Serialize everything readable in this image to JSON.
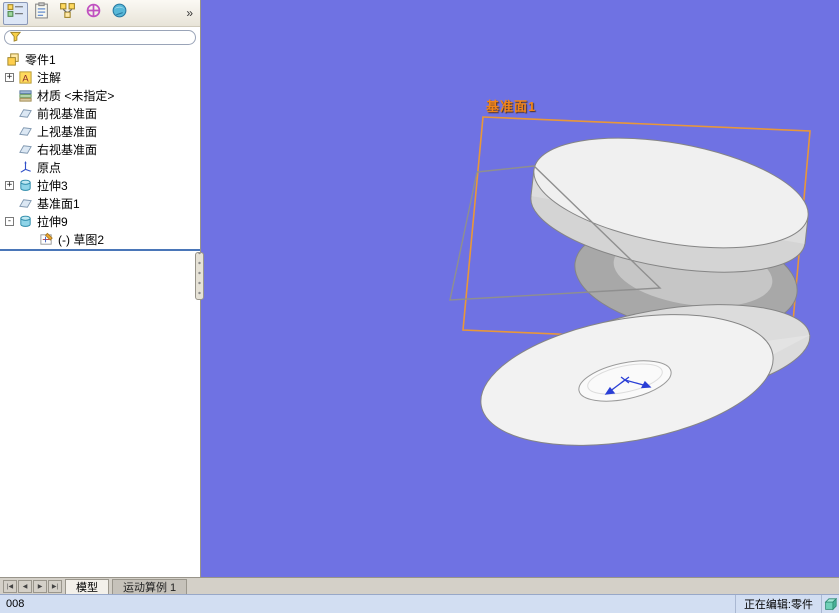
{
  "panel": {
    "toolbar": {
      "overflow_label": "»",
      "icons": [
        "featuremanager-tree-icon",
        "propertymanager-icon",
        "configurationmanager-icon",
        "dimxpertmanager-icon",
        "displaymanager-icon"
      ]
    },
    "filter": {
      "placeholder": "",
      "icon": "filter-funnel-icon"
    },
    "tree": [
      {
        "label": "零件1",
        "icon": "part-icon",
        "expand": ""
      },
      {
        "label": "注解",
        "icon": "annotations-icon",
        "expand": "+"
      },
      {
        "label": "材质 <未指定>",
        "icon": "material-icon",
        "expand": ""
      },
      {
        "label": "前视基准面",
        "icon": "plane-icon",
        "expand": ""
      },
      {
        "label": "上视基准面",
        "icon": "plane-icon",
        "expand": ""
      },
      {
        "label": "右视基准面",
        "icon": "plane-icon",
        "expand": ""
      },
      {
        "label": "原点",
        "icon": "origin-icon",
        "expand": ""
      },
      {
        "label": "拉伸3",
        "icon": "extrude-icon",
        "expand": "+"
      },
      {
        "label": "基准面1",
        "icon": "plane-icon",
        "expand": ""
      },
      {
        "label": "拉伸9",
        "icon": "extrude-icon",
        "expand": "-"
      },
      {
        "label": "(-) 草图2",
        "icon": "sketch-icon",
        "expand": ""
      }
    ]
  },
  "viewport": {
    "plane_label": "基准面1",
    "colors": {
      "background": "#6f72e3",
      "plane": "#e8973a",
      "sketch": "#8f8f8f",
      "model_light": "#f2f2f2",
      "model_dark": "#a8a8a8"
    }
  },
  "tabs": {
    "nav": [
      "|◀",
      "◀",
      "▶",
      "▶|"
    ],
    "items": [
      {
        "label": "模型",
        "active": true
      },
      {
        "label": "运动算例 1",
        "active": false
      }
    ]
  },
  "statusbar": {
    "left": "008",
    "right": "正在编辑:零件"
  }
}
